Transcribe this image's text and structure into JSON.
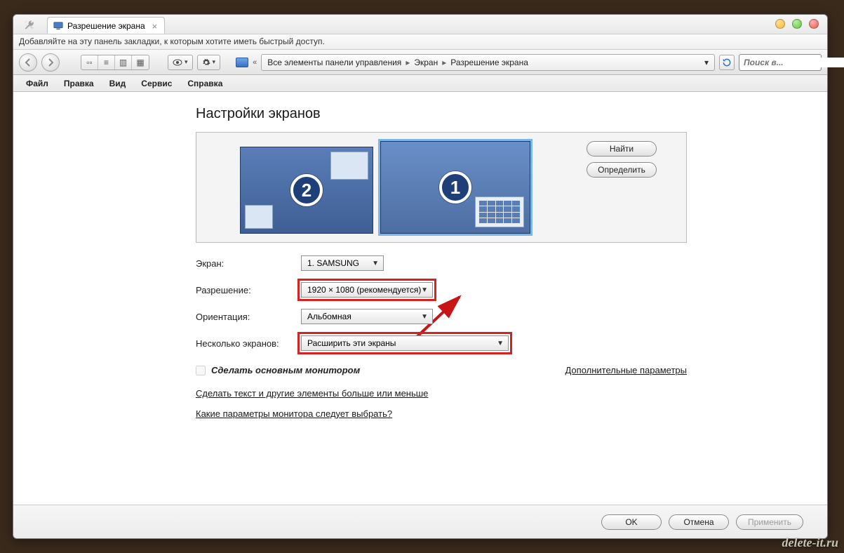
{
  "tab": {
    "title": "Разрешение экрана"
  },
  "bookbar_hint": "Добавляйте на эту панель закладки, к которым хотите иметь быстрый доступ.",
  "breadcrumb": {
    "root": "Все элементы панели управления",
    "seg1": "Экран",
    "seg2": "Разрешение экрана"
  },
  "search": {
    "placeholder": "Поиск в..."
  },
  "menus": {
    "file": "Файл",
    "edit": "Правка",
    "view": "Вид",
    "service": "Сервис",
    "help": "Справка"
  },
  "page_title": "Настройки экранов",
  "monitors": {
    "m1": "1",
    "m2": "2"
  },
  "side": {
    "find": "Найти",
    "identify": "Определить"
  },
  "fields": {
    "screen_label": "Экран:",
    "screen_value": "1. SAMSUNG",
    "res_label": "Разрешение:",
    "res_value": "1920 × 1080 (рекомендуется)",
    "orient_label": "Ориентация:",
    "orient_value": "Альбомная",
    "multi_label": "Несколько экранов:",
    "multi_value": "Расширить эти экраны"
  },
  "checkbox_label": "Сделать основным монитором",
  "extra_link": "Дополнительные параметры",
  "link1": "Сделать текст и другие элементы больше или меньше",
  "link2": "Какие параметры монитора следует выбрать?",
  "buttons": {
    "ok": "OK",
    "cancel": "Отмена",
    "apply": "Применить"
  },
  "watermark": "delete-it.ru"
}
